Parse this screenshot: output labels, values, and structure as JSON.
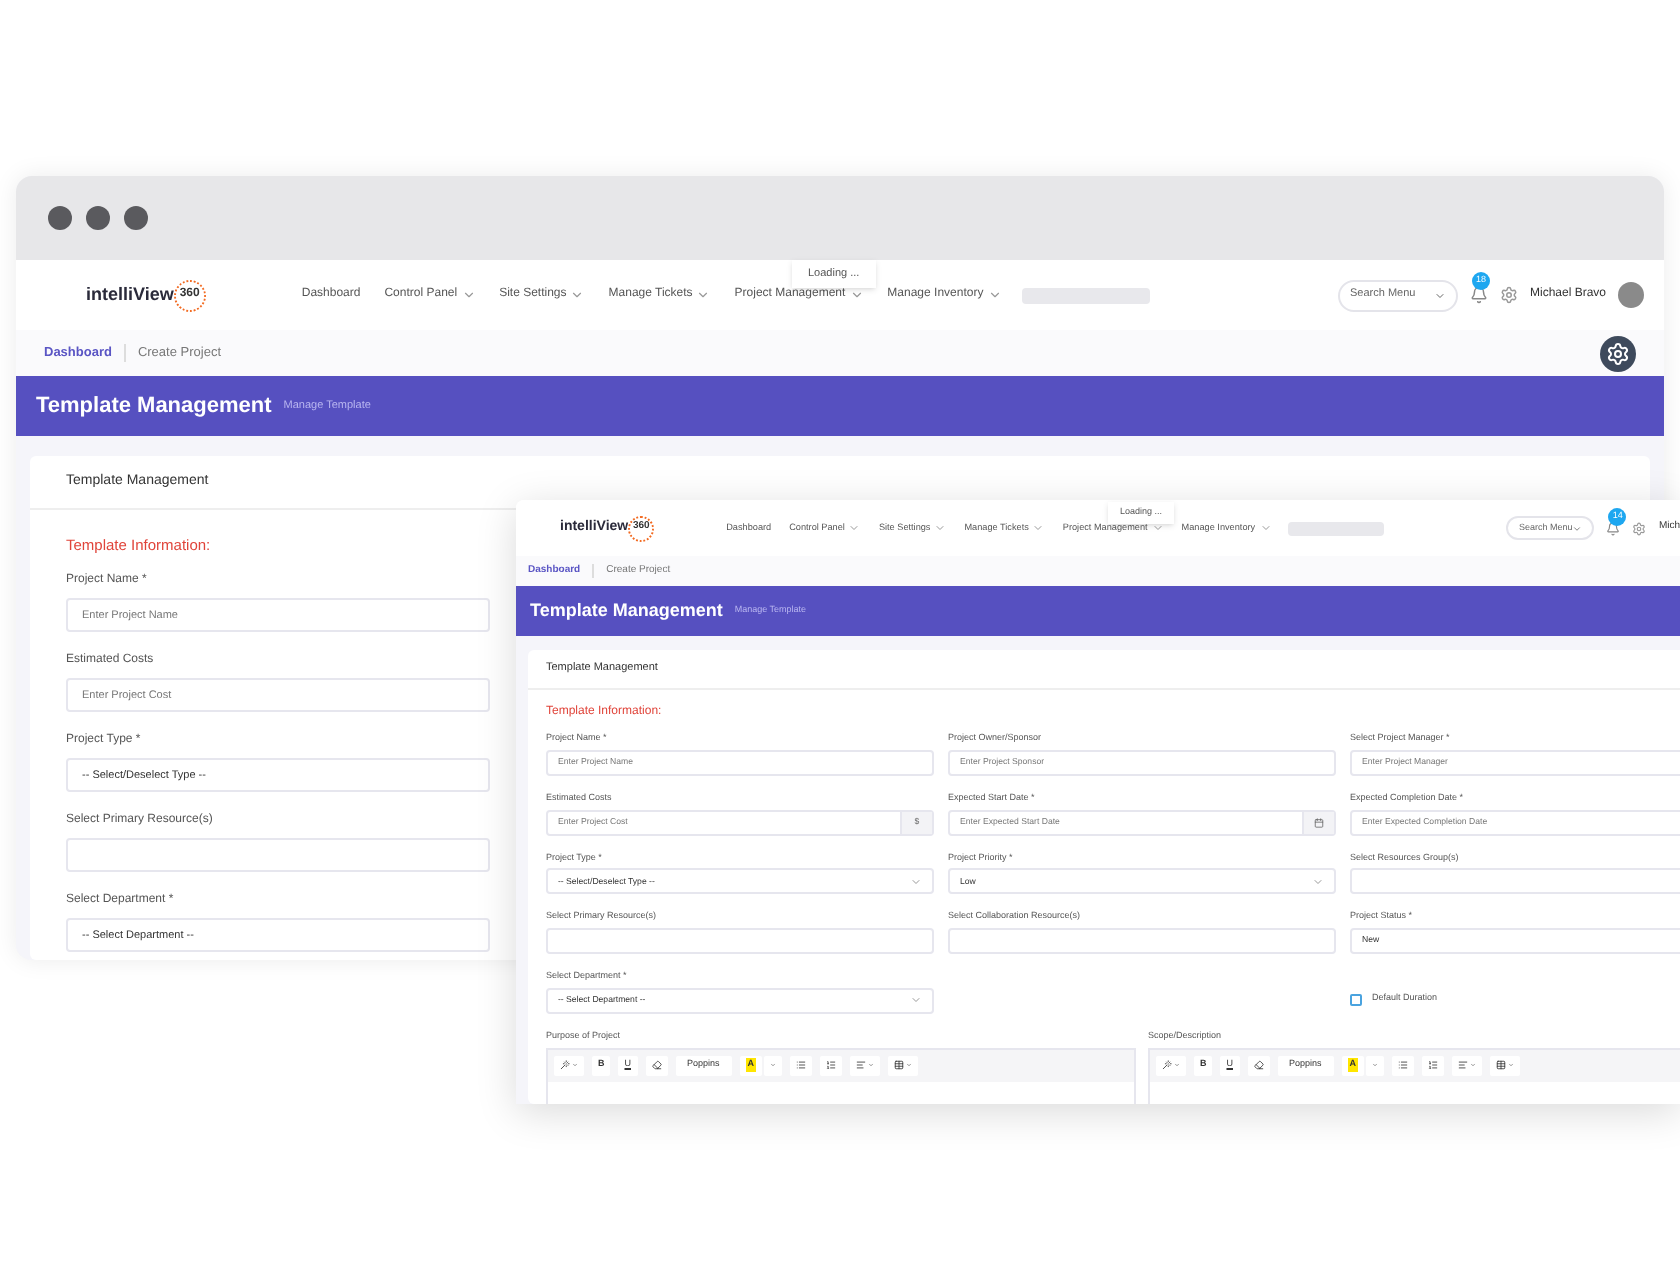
{
  "back_window": {
    "logo": {
      "name": "intelliView",
      "badge": "360"
    },
    "nav": [
      {
        "label": "Dashboard",
        "dropdown": false
      },
      {
        "label": "Control Panel",
        "dropdown": true
      },
      {
        "label": "Site Settings",
        "dropdown": true
      },
      {
        "label": "Manage Tickets",
        "dropdown": true
      },
      {
        "label": "Project Management",
        "dropdown": true
      },
      {
        "label": "Manage Inventory",
        "dropdown": true
      }
    ],
    "loading": "Loading ...",
    "search": {
      "placeholder": "Search Menu"
    },
    "notifications": "18",
    "user": "Michael Bravo",
    "breadcrumb": [
      {
        "label": "Dashboard",
        "selected": false
      },
      {
        "label": "Create Project",
        "selected": true
      }
    ],
    "page_title": "Template Management",
    "page_subtitle": "Manage Template",
    "card_title": "Template Management",
    "section_title": "Template Information:",
    "fields": [
      {
        "label": "Project Name *",
        "placeholder": "Enter Project Name"
      },
      {
        "label": "Estimated Costs",
        "placeholder": "Enter Project Cost"
      },
      {
        "label": "Project Type *",
        "value": "-- Select/Deselect Type --"
      },
      {
        "label": "Select Primary Resource(s)"
      },
      {
        "label": "Select Department *",
        "value": "-- Select Department --"
      }
    ]
  },
  "front_window": {
    "logo": {
      "name": "intelliView",
      "badge": "360"
    },
    "nav": [
      {
        "label": "Dashboard",
        "dropdown": false
      },
      {
        "label": "Control Panel",
        "dropdown": true
      },
      {
        "label": "Site Settings",
        "dropdown": true
      },
      {
        "label": "Manage Tickets",
        "dropdown": true
      },
      {
        "label": "Project Management",
        "dropdown": true
      },
      {
        "label": "Manage Inventory",
        "dropdown": true
      }
    ],
    "loading": "Loading ...",
    "search": {
      "placeholder": "Search Menu"
    },
    "notifications": "14",
    "user": "Mich",
    "breadcrumb": [
      {
        "label": "Dashboard",
        "selected": false
      },
      {
        "label": "Create Project",
        "selected": true
      }
    ],
    "page_title": "Template Management",
    "page_subtitle": "Manage Template",
    "card_title": "Template Management",
    "section_title": "Template Information:",
    "fields": [
      {
        "kind": "text",
        "label": "Project Name *",
        "placeholder": "Enter Project Name"
      },
      {
        "kind": "text",
        "label": "Project Owner/Sponsor",
        "placeholder": "Enter Project Sponsor"
      },
      {
        "kind": "text",
        "label": "Select Project Manager *",
        "placeholder": "Enter Project Manager"
      },
      {
        "kind": "currency",
        "label": "Estimated Costs",
        "placeholder": "Enter Project Cost",
        "addon": "$"
      },
      {
        "kind": "date",
        "label": "Expected Start Date *",
        "placeholder": "Enter Expected Start Date"
      },
      {
        "kind": "text",
        "label": "Expected Completion Date *",
        "placeholder": "Enter Expected Completion Date"
      },
      {
        "kind": "select",
        "label": "Project Type *",
        "value": "-- Select/Deselect Type --"
      },
      {
        "kind": "select",
        "label": "Project Priority *",
        "value": "Low"
      },
      {
        "kind": "text",
        "label": "Select Resources Group(s)"
      },
      {
        "kind": "text",
        "label": "Select Primary Resource(s)"
      },
      {
        "kind": "text",
        "label": "Select Collaboration Resource(s)"
      },
      {
        "kind": "text",
        "label": "Project Status *",
        "value": "New"
      },
      {
        "kind": "select",
        "label": "Select Department *",
        "value": "-- Select Department --"
      },
      {
        "kind": "checkbox",
        "label": "Default Duration",
        "checked": false
      }
    ],
    "editors": [
      {
        "label": "Purpose of Project",
        "toolbar": [
          {
            "kind": "style"
          },
          {
            "kind": "bold",
            "label": "B"
          },
          {
            "kind": "underline",
            "label": "U"
          },
          {
            "kind": "clear"
          },
          {
            "kind": "font",
            "label": "Poppins"
          },
          {
            "kind": "color",
            "label": "A"
          },
          {
            "kind": "bulleted-list"
          },
          {
            "kind": "numbered-list"
          },
          {
            "kind": "align"
          },
          {
            "kind": "table"
          }
        ]
      },
      {
        "label": "Scope/Description",
        "toolbar": [
          {
            "kind": "style"
          },
          {
            "kind": "bold",
            "label": "B"
          },
          {
            "kind": "underline",
            "label": "U"
          },
          {
            "kind": "clear"
          },
          {
            "kind": "font",
            "label": "Poppins"
          },
          {
            "kind": "color",
            "label": "A"
          },
          {
            "kind": "bulleted-list"
          },
          {
            "kind": "numbered-list"
          },
          {
            "kind": "align"
          },
          {
            "kind": "table"
          }
        ]
      }
    ]
  }
}
